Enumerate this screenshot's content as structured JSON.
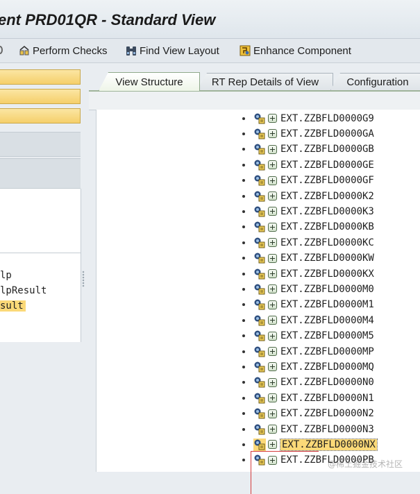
{
  "window": {
    "title": "ent PRD01QR - Standard View"
  },
  "toolbar": {
    "perform_checks": "Perform Checks",
    "find_view_layout": "Find View Layout",
    "enhance_component": "Enhance Component"
  },
  "left_pane": {
    "lines": [
      "lp",
      "lpResult",
      "sult"
    ]
  },
  "tabs": [
    "View Structure",
    "RT Rep Details of View",
    "Configuration"
  ],
  "tree": {
    "nodes": [
      "EXT.ZZBFLD0000G9",
      "EXT.ZZBFLD0000GA",
      "EXT.ZZBFLD0000GB",
      "EXT.ZZBFLD0000GE",
      "EXT.ZZBFLD0000GF",
      "EXT.ZZBFLD0000K2",
      "EXT.ZZBFLD0000K3",
      "EXT.ZZBFLD0000KB",
      "EXT.ZZBFLD0000KC",
      "EXT.ZZBFLD0000KW",
      "EXT.ZZBFLD0000KX",
      "EXT.ZZBFLD0000M0",
      "EXT.ZZBFLD0000M1",
      "EXT.ZZBFLD0000M4",
      "EXT.ZZBFLD0000M5",
      "EXT.ZZBFLD0000MP",
      "EXT.ZZBFLD0000MQ",
      "EXT.ZZBFLD0000N0",
      "EXT.ZZBFLD0000N1",
      "EXT.ZZBFLD0000N2",
      "EXT.ZZBFLD0000N3",
      "EXT.ZZBFLD0000NX",
      "EXT.ZZBFLD0000PB"
    ],
    "selected": "EXT.ZZBFLD0000NX"
  },
  "watermark": "@稀土掘金技术社区",
  "colors": {
    "highlight": "#fbd978",
    "active_tab": "#eef5e8",
    "redmark": "#d43b3b"
  },
  "icons": [
    "perform-checks-icon",
    "binoculars-icon",
    "enhance-component-icon",
    "view-node-icon",
    "expand-plus-icon"
  ]
}
